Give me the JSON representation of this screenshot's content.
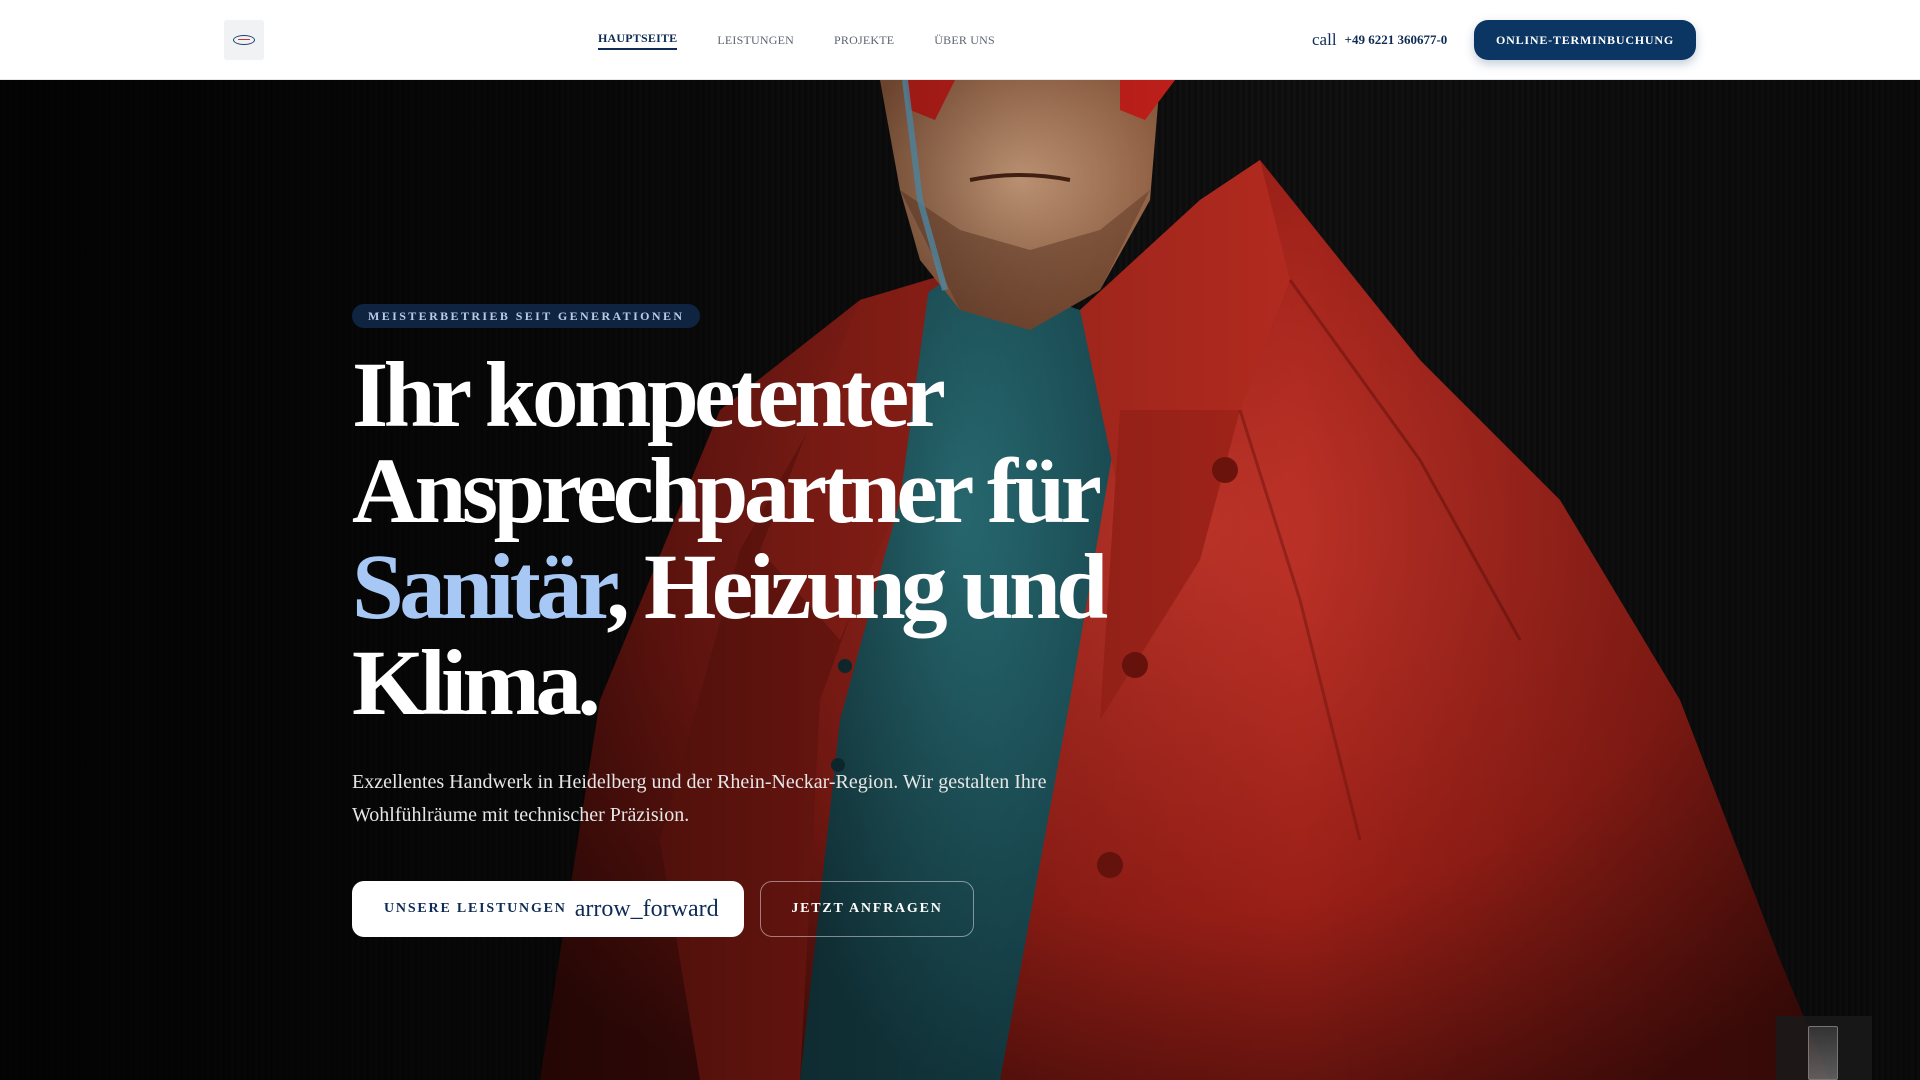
{
  "header": {
    "nav": [
      {
        "label": "HAUPTSEITE",
        "active": true
      },
      {
        "label": "LEISTUNGEN",
        "active": false
      },
      {
        "label": "PROJEKTE",
        "active": false
      },
      {
        "label": "ÜBER UNS",
        "active": false
      }
    ],
    "call_icon": "call",
    "phone": "+49 6221 360677-0",
    "booking_label": "ONLINE-TERMINBUCHUNG"
  },
  "hero": {
    "badge": "MEISTERBETRIEB SEIT GENERATIONEN",
    "headline_part1": "Ihr kompetenter Ansprechpartner für",
    "headline_accent": "Sanitär",
    "headline_part2": ", Heizung und Klima.",
    "subtext": "Exzellentes Handwerk in Heidelberg und der Rhein-Neckar-Region. Wir gestalten Ihre Wohlfühlräume mit technischer Präzision.",
    "primary_button": "UNSERE LEISTUNGEN",
    "primary_button_icon": "arrow_forward",
    "secondary_button": "JETZT ANFRAGEN"
  },
  "colors": {
    "brand_navy": "#0b3563",
    "accent_blue": "#a7c8f5",
    "jacket_red": "#b8281c"
  }
}
